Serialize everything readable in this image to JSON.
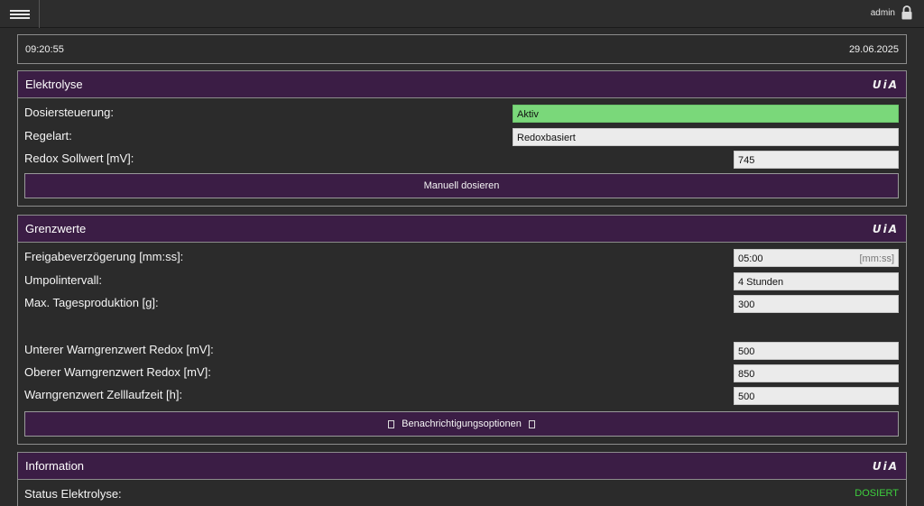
{
  "header": {
    "menu_icon": "hamburger-icon",
    "user": "admin",
    "lock_icon": "lock-icon"
  },
  "clock": {
    "time": "09:20:55",
    "date": "29.06.2025"
  },
  "logo_text": "UiA",
  "elektrolyse": {
    "title": "Elektrolyse",
    "dosiersteuerung_label": "Dosiersteuerung:",
    "dosiersteuerung_value": "Aktiv",
    "regelart_label": "Regelart:",
    "regelart_value": "Redoxbasiert",
    "sollwert_label": "Redox Sollwert [mV]:",
    "sollwert_value": "745",
    "manual_button": "Manuell dosieren"
  },
  "grenzwerte": {
    "title": "Grenzwerte",
    "freigabe_label": "Freigabeverzögerung [mm:ss]:",
    "freigabe_value": "05:00",
    "freigabe_unit": "[mm:ss]",
    "umpol_label": "Umpolintervall:",
    "umpol_value": "4 Stunden",
    "tages_label": "Max. Tagesproduktion [g]:",
    "tages_value": "300",
    "unterer_label": "Unterer Warngrenzwert Redox [mV]:",
    "unterer_value": "500",
    "oberer_label": "Oberer Warngrenzwert Redox [mV]:",
    "oberer_value": "850",
    "zelllauf_label": "Warngrenzwert Zelllaufzeit [h]:",
    "zelllauf_value": "500",
    "notify_button": "Benachrichtigungsoptionen"
  },
  "information": {
    "title": "Information",
    "status_label": "Status Elektrolyse:",
    "status_value": "DOSIERT"
  },
  "colors": {
    "header_purple": "#3b1d45",
    "active_green": "#7ad87a",
    "status_green": "#3ecf3e"
  }
}
